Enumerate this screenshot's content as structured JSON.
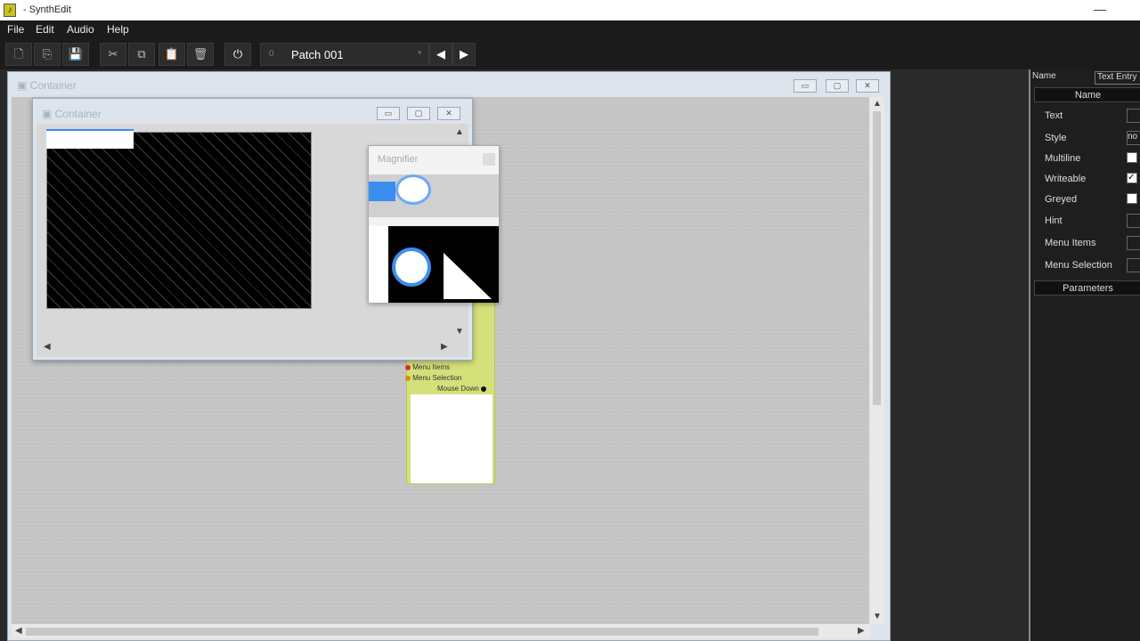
{
  "app": {
    "title": "- SynthEdit"
  },
  "menu": [
    "File",
    "Edit",
    "Audio",
    "Help"
  ],
  "toolbar": {
    "patch_number": "0",
    "patch_name": "Patch 001"
  },
  "outer_window": {
    "title": "Container"
  },
  "inner_window": {
    "title": "Container"
  },
  "magnifier": {
    "title": "Magnifier"
  },
  "module": {
    "pins": [
      "Menu Items",
      "Menu Selection",
      "Mouse Down"
    ]
  },
  "panel": {
    "name_label": "Name",
    "name_value": "Text Entry",
    "column_header": "Name",
    "rows": [
      "Text",
      "Style",
      "Multiline",
      "Writeable",
      "Greyed",
      "Hint",
      "Menu Items",
      "Menu Selection"
    ],
    "style_value": "no",
    "parameters_header": "Parameters"
  }
}
